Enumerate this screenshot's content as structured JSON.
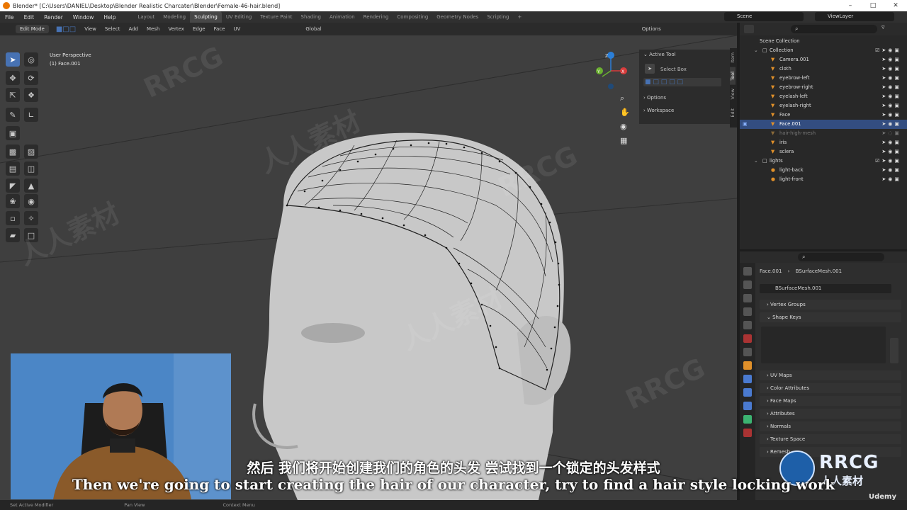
{
  "window": {
    "title": "Blender* [C:\\Users\\DANIEL\\Desktop\\Blender Realistic Charcater\\Blender\\Female-46-hair.blend]"
  },
  "menu": [
    "File",
    "Edit",
    "Render",
    "Window",
    "Help"
  ],
  "workspaces": [
    "Layout",
    "Modeling",
    "Sculpting",
    "UV Editing",
    "Texture Paint",
    "Shading",
    "Animation",
    "Rendering",
    "Compositing",
    "Geometry Nodes",
    "Scripting"
  ],
  "active_workspace": "Sculpting",
  "scene": "Scene",
  "view_layer": "ViewLayer",
  "viewport_header": {
    "mode": "Edit Mode",
    "menus": [
      "View",
      "Select",
      "Add",
      "Mesh",
      "Vertex",
      "Edge",
      "Face",
      "UV"
    ],
    "orientation": "Global",
    "options": "Options"
  },
  "gizmo_axes": {
    "x": "X",
    "y": "Y",
    "z": "Z"
  },
  "viewport_info": {
    "perspective": "User Perspective",
    "object": "(1) Face.001"
  },
  "n_panel": {
    "active_tool": "Active Tool",
    "tool": "Select Box",
    "options": "Options",
    "workspace": "Workspace"
  },
  "n_tabs": [
    "Item",
    "Tool",
    "View",
    "Edit"
  ],
  "outliner": {
    "root": "Scene Collection",
    "rows": [
      {
        "name": "Collection"
      },
      {
        "name": "Camera.001"
      },
      {
        "name": "cloth"
      },
      {
        "name": "eyebrow-left"
      },
      {
        "name": "eyebrow-right"
      },
      {
        "name": "eyelash-left"
      },
      {
        "name": "eyelash-right"
      },
      {
        "name": "Face"
      },
      {
        "name": "Face.001",
        "selected": true
      },
      {
        "name": "hair-high-mesh",
        "dim": true
      },
      {
        "name": "iris"
      },
      {
        "name": "sclera"
      },
      {
        "name": "lights"
      },
      {
        "name": "light-back"
      },
      {
        "name": "light-front"
      }
    ]
  },
  "properties": {
    "breadcrumb_object": "Face.001",
    "breadcrumb_data": "BSurfaceMesh.001",
    "data_name": "BSurfaceMesh.001",
    "sections": [
      "Vertex Groups",
      "Shape Keys",
      "UV Maps",
      "Color Attributes",
      "Face Maps",
      "Attributes",
      "Normals",
      "Texture Space",
      "Remesh"
    ]
  },
  "statusbar": [
    "Set Active Modifier",
    "Pan View",
    "Context Menu"
  ],
  "subtitles": {
    "cn": "然后 我们将开始创建我们的角色的头发 尝试找到一个锁定的头发样式",
    "en": "Then we're going to start creating the hair of our character, try to find a hair style locking work"
  },
  "watermarks": {
    "brand": "RRCG",
    "cn": "人人素材",
    "udemy": "Udemy"
  },
  "colors": {
    "accent": "#4772b3",
    "selected_row": "#334d80",
    "blender_orange": "#ea7600"
  }
}
